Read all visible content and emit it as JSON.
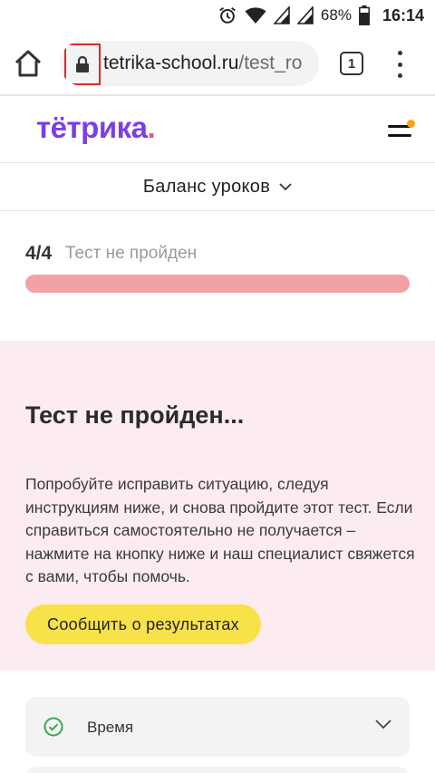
{
  "status_bar": {
    "battery_percent": "68%",
    "time": "16:14"
  },
  "browser": {
    "url_domain": "tetrika-school.ru",
    "url_path": "/test_ro",
    "tab_count": "1"
  },
  "site_header": {
    "logo_main": "тётрика",
    "logo_dot": "."
  },
  "balance": {
    "label": "Баланс уроков"
  },
  "progress": {
    "count": "4/4",
    "status": "Тест не пройден",
    "value": 1.0
  },
  "result": {
    "title": "Тест не пройден...",
    "text": "Попробуйте исправить ситуацию, следуя инструкциям ниже, и снова пройдите этот тест. Если справиться самостоятельно не получается – нажмите на кнопку ниже и наш специалист свяжется с вами, чтобы помочь.",
    "button_label": "Сообщить о результатах"
  },
  "accordion": {
    "label": "Время"
  },
  "colors": {
    "brand_purple": "#7b3fe4",
    "brand_pink": "#f0508c",
    "progress_fill": "#f2a1a4",
    "result_bg": "#fcecef",
    "button_yellow": "#f8e24a",
    "check_green": "#3aa757",
    "notification_orange": "#f7a21b"
  }
}
